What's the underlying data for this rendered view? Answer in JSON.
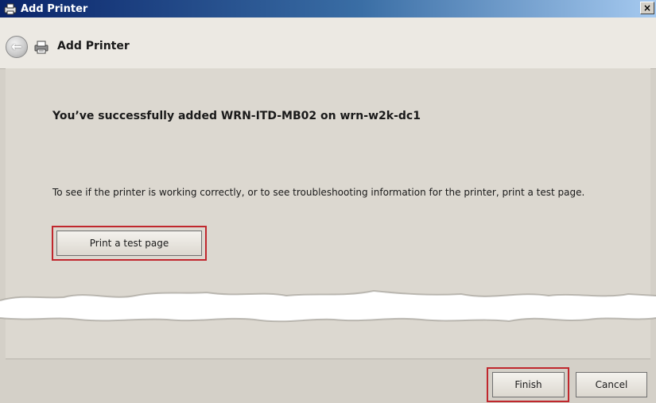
{
  "window": {
    "title": "Add Printer",
    "close_label": "×"
  },
  "nav": {
    "back_glyph": "←",
    "title": "Add Printer"
  },
  "main": {
    "headline": "You’ve successfully added WRN-ITD-MB02 on wrn-w2k-dc1",
    "instructions": "To see if the printer is working correctly, or to see troubleshooting information for the printer, print a test page.",
    "test_page_button": "Print a test page"
  },
  "footer": {
    "finish_button": "Finish",
    "cancel_button": "Cancel"
  },
  "colors": {
    "highlight": "#c0272d",
    "titlebar": "#0a246a",
    "dialog_bg": "#dcd8d0"
  },
  "icons": {
    "window_icon": "printer-icon",
    "back": "back-arrow-icon",
    "nav_icon": "printer-icon"
  }
}
